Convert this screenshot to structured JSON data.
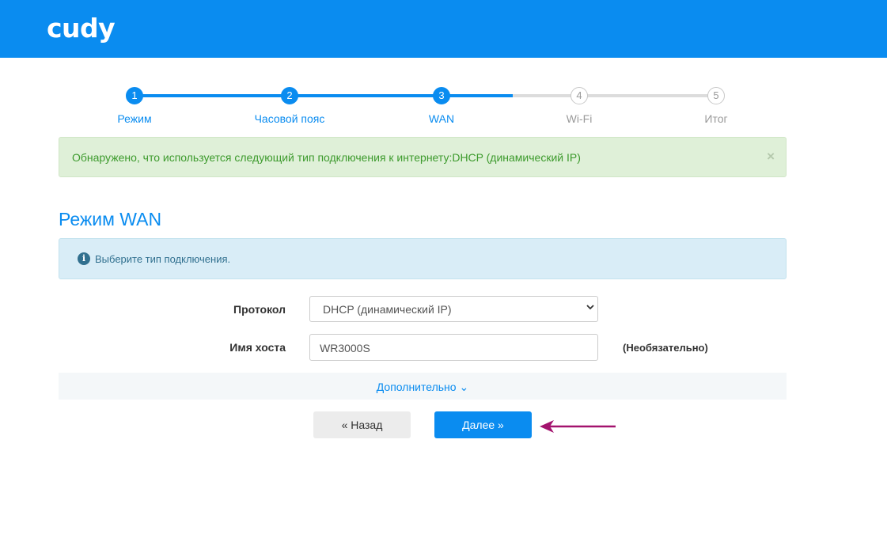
{
  "brand": {
    "logo": "cudy",
    "color": "#0a8cf0"
  },
  "steps": [
    {
      "num": "1",
      "label": "Режим",
      "state": "done"
    },
    {
      "num": "2",
      "label": "Часовой пояс",
      "state": "done"
    },
    {
      "num": "3",
      "label": "WAN",
      "state": "done"
    },
    {
      "num": "4",
      "label": "Wi-Fi",
      "state": "todo"
    },
    {
      "num": "5",
      "label": "Итог",
      "state": "todo"
    }
  ],
  "alert_success": {
    "text": "Обнаружено, что используется следующий тип подключения к интернету:DHCP (динамический IP)",
    "close": "×"
  },
  "section": {
    "title": "Режим WAN"
  },
  "alert_info": {
    "icon": "info-icon",
    "text": "Выберите тип подключения."
  },
  "form": {
    "protocol": {
      "label": "Протокол",
      "value": "DHCP (динамический IP)"
    },
    "hostname": {
      "label": "Имя хоста",
      "value": "WR3000S",
      "hint": "(Необязательно)"
    }
  },
  "advanced": {
    "label": "Дополнительно ⌄"
  },
  "buttons": {
    "back": "« Назад",
    "next": "Далее »"
  },
  "annotation": {
    "arrow_color": "#a3136e"
  }
}
